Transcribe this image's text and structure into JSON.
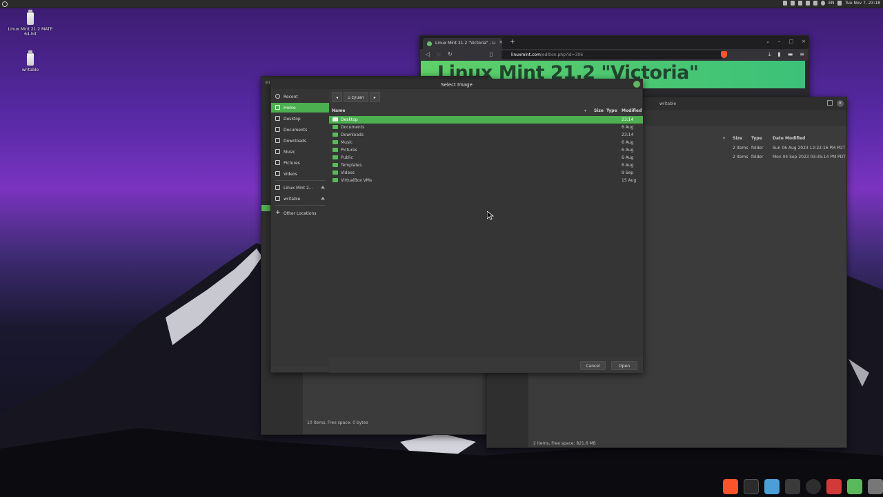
{
  "top_panel": {
    "keyboard_layout": "EN",
    "clock": "Tue Nov 7, 23:18"
  },
  "desktop_icons": [
    {
      "label": "Linux Mint 21.2 MATE 64-bit"
    },
    {
      "label": "writable"
    }
  ],
  "browser": {
    "tab_title": "Linux Mint 21.2 \"Victoria\" - Li",
    "url_host": "linuxmint.com",
    "url_path": "/edition.php?id=306",
    "page_heading": "Linux Mint 21.2 \"Victoria\""
  },
  "fm_left": {
    "title_fragment": "Fil",
    "status": "10 items, Free space: 0 bytes"
  },
  "fm_right": {
    "title": "writable",
    "columns": [
      "Size",
      "Type",
      "Date Modified"
    ],
    "rows": [
      {
        "size": "2 items",
        "type": "folder",
        "modified": "Sun 06 Aug 2023 12:22:16 PM PDT"
      },
      {
        "size": "2 items",
        "type": "folder",
        "modified": "Mon 04 Sep 2023 03:35:14 PM PDT"
      }
    ],
    "status": "2 items, Free space: 821.6 MB"
  },
  "dialog": {
    "title": "Select Image",
    "places": [
      {
        "label": "Recent",
        "icon": "clock-icon"
      },
      {
        "label": "Home",
        "icon": "home-icon",
        "selected": true
      },
      {
        "label": "Desktop",
        "icon": "desktop-icon"
      },
      {
        "label": "Documents",
        "icon": "document-icon"
      },
      {
        "label": "Downloads",
        "icon": "download-icon"
      },
      {
        "label": "Music",
        "icon": "music-icon"
      },
      {
        "label": "Pictures",
        "icon": "picture-icon"
      },
      {
        "label": "Videos",
        "icon": "video-icon"
      },
      {
        "label": "Linux Mint 2...",
        "icon": "drive-icon",
        "eject": true
      },
      {
        "label": "writable",
        "icon": "drive-icon",
        "eject": true
      },
      {
        "label": "Other Locations",
        "icon": "plus-icon"
      }
    ],
    "path_current": "zyuan",
    "columns": {
      "name": "Name",
      "size": "Size",
      "type": "Type",
      "modified": "Modified"
    },
    "files": [
      {
        "name": "Desktop",
        "modified": "23:14",
        "selected": true
      },
      {
        "name": "Documents",
        "modified": "6 Aug"
      },
      {
        "name": "Downloads",
        "modified": "23:14"
      },
      {
        "name": "Music",
        "modified": "6 Aug"
      },
      {
        "name": "Pictures",
        "modified": "6 Aug"
      },
      {
        "name": "Public",
        "modified": "6 Aug"
      },
      {
        "name": "Templates",
        "modified": "6 Aug"
      },
      {
        "name": "Videos",
        "modified": "9 Sep"
      },
      {
        "name": "VirtualBox VMs",
        "modified": "15 Aug"
      }
    ],
    "cancel_label": "Cancel",
    "open_label": "Open"
  },
  "colors": {
    "accent": "#4caf50",
    "window_bg": "#383838",
    "desktop_purple": "#6a2fb5"
  }
}
